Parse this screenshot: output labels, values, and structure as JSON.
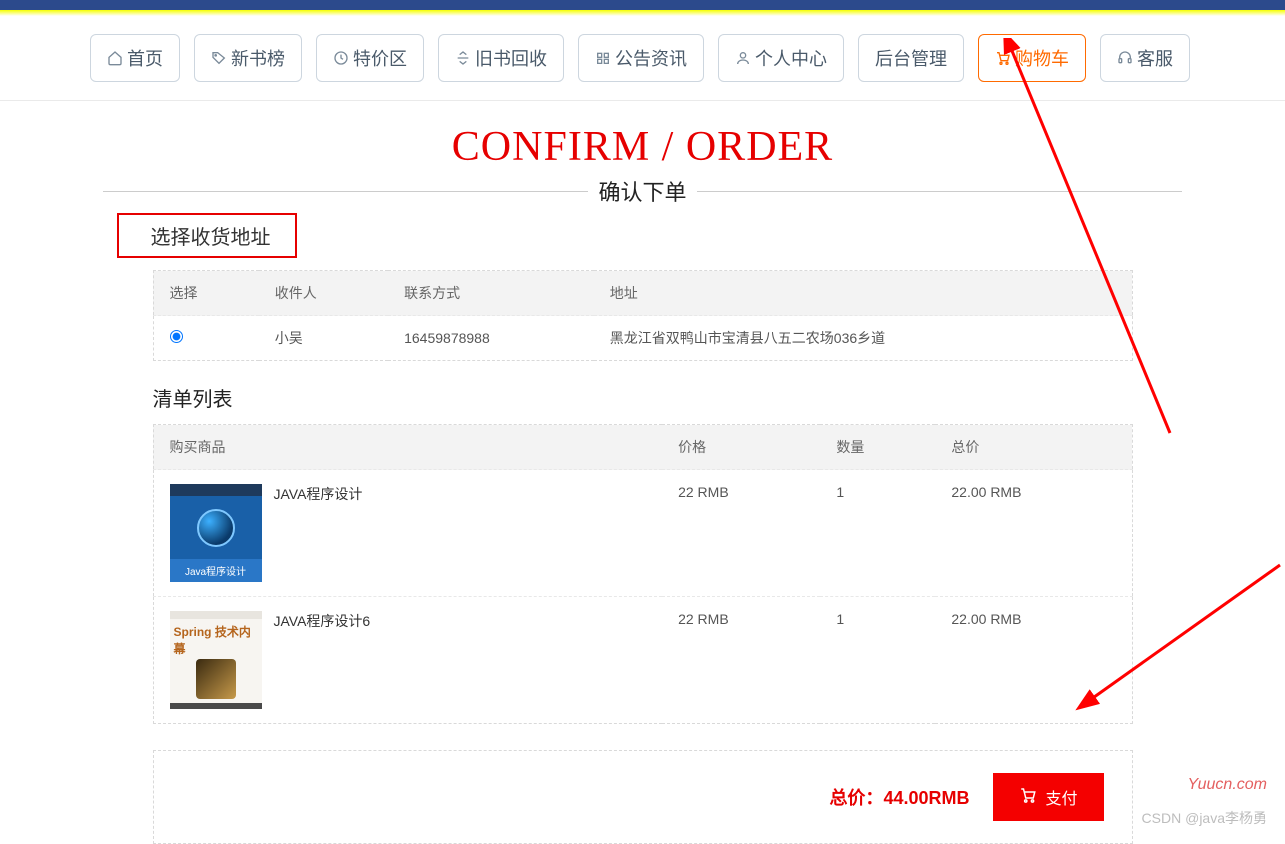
{
  "nav": {
    "items": [
      {
        "label": "首页",
        "icon": "home-icon"
      },
      {
        "label": "新书榜",
        "icon": "tag-icon"
      },
      {
        "label": "特价区",
        "icon": "clock-icon"
      },
      {
        "label": "旧书回收",
        "icon": "recycle-icon"
      },
      {
        "label": "公告资讯",
        "icon": "news-icon"
      },
      {
        "label": "个人中心",
        "icon": "person-icon"
      },
      {
        "label": "后台管理",
        "icon": ""
      },
      {
        "label": "购物车",
        "icon": "cart-icon",
        "active": true
      },
      {
        "label": "客服",
        "icon": "headset-icon"
      }
    ]
  },
  "page": {
    "title_en": "CONFIRM / ORDER",
    "title_cn": "确认下单",
    "address_heading": "选择收货地址",
    "list_heading": "清单列表"
  },
  "address_table": {
    "headers": {
      "select": "选择",
      "recipient": "收件人",
      "contact": "联系方式",
      "address": "地址"
    },
    "rows": [
      {
        "selected": true,
        "recipient": "小吴",
        "contact": "16459878988",
        "address": "黑龙江省双鸭山市宝清县八五二农场036乡道"
      }
    ]
  },
  "items_table": {
    "headers": {
      "product": "购买商品",
      "price": "价格",
      "qty": "数量",
      "total": "总价"
    },
    "rows": [
      {
        "name": "JAVA程序设计",
        "cover_label": "Java程序设计",
        "price": "22 RMB",
        "qty": "1",
        "total": "22.00 RMB"
      },
      {
        "name": "JAVA程序设计6",
        "cover_title": "Spring 技术内幕",
        "price": "22 RMB",
        "qty": "1",
        "total": "22.00 RMB"
      }
    ]
  },
  "footer": {
    "total_label": "总价：",
    "total_value": "44.00RMB",
    "pay_label": "支付"
  },
  "watermark": "Yuucn.com",
  "csdn": "CSDN @java李杨勇"
}
